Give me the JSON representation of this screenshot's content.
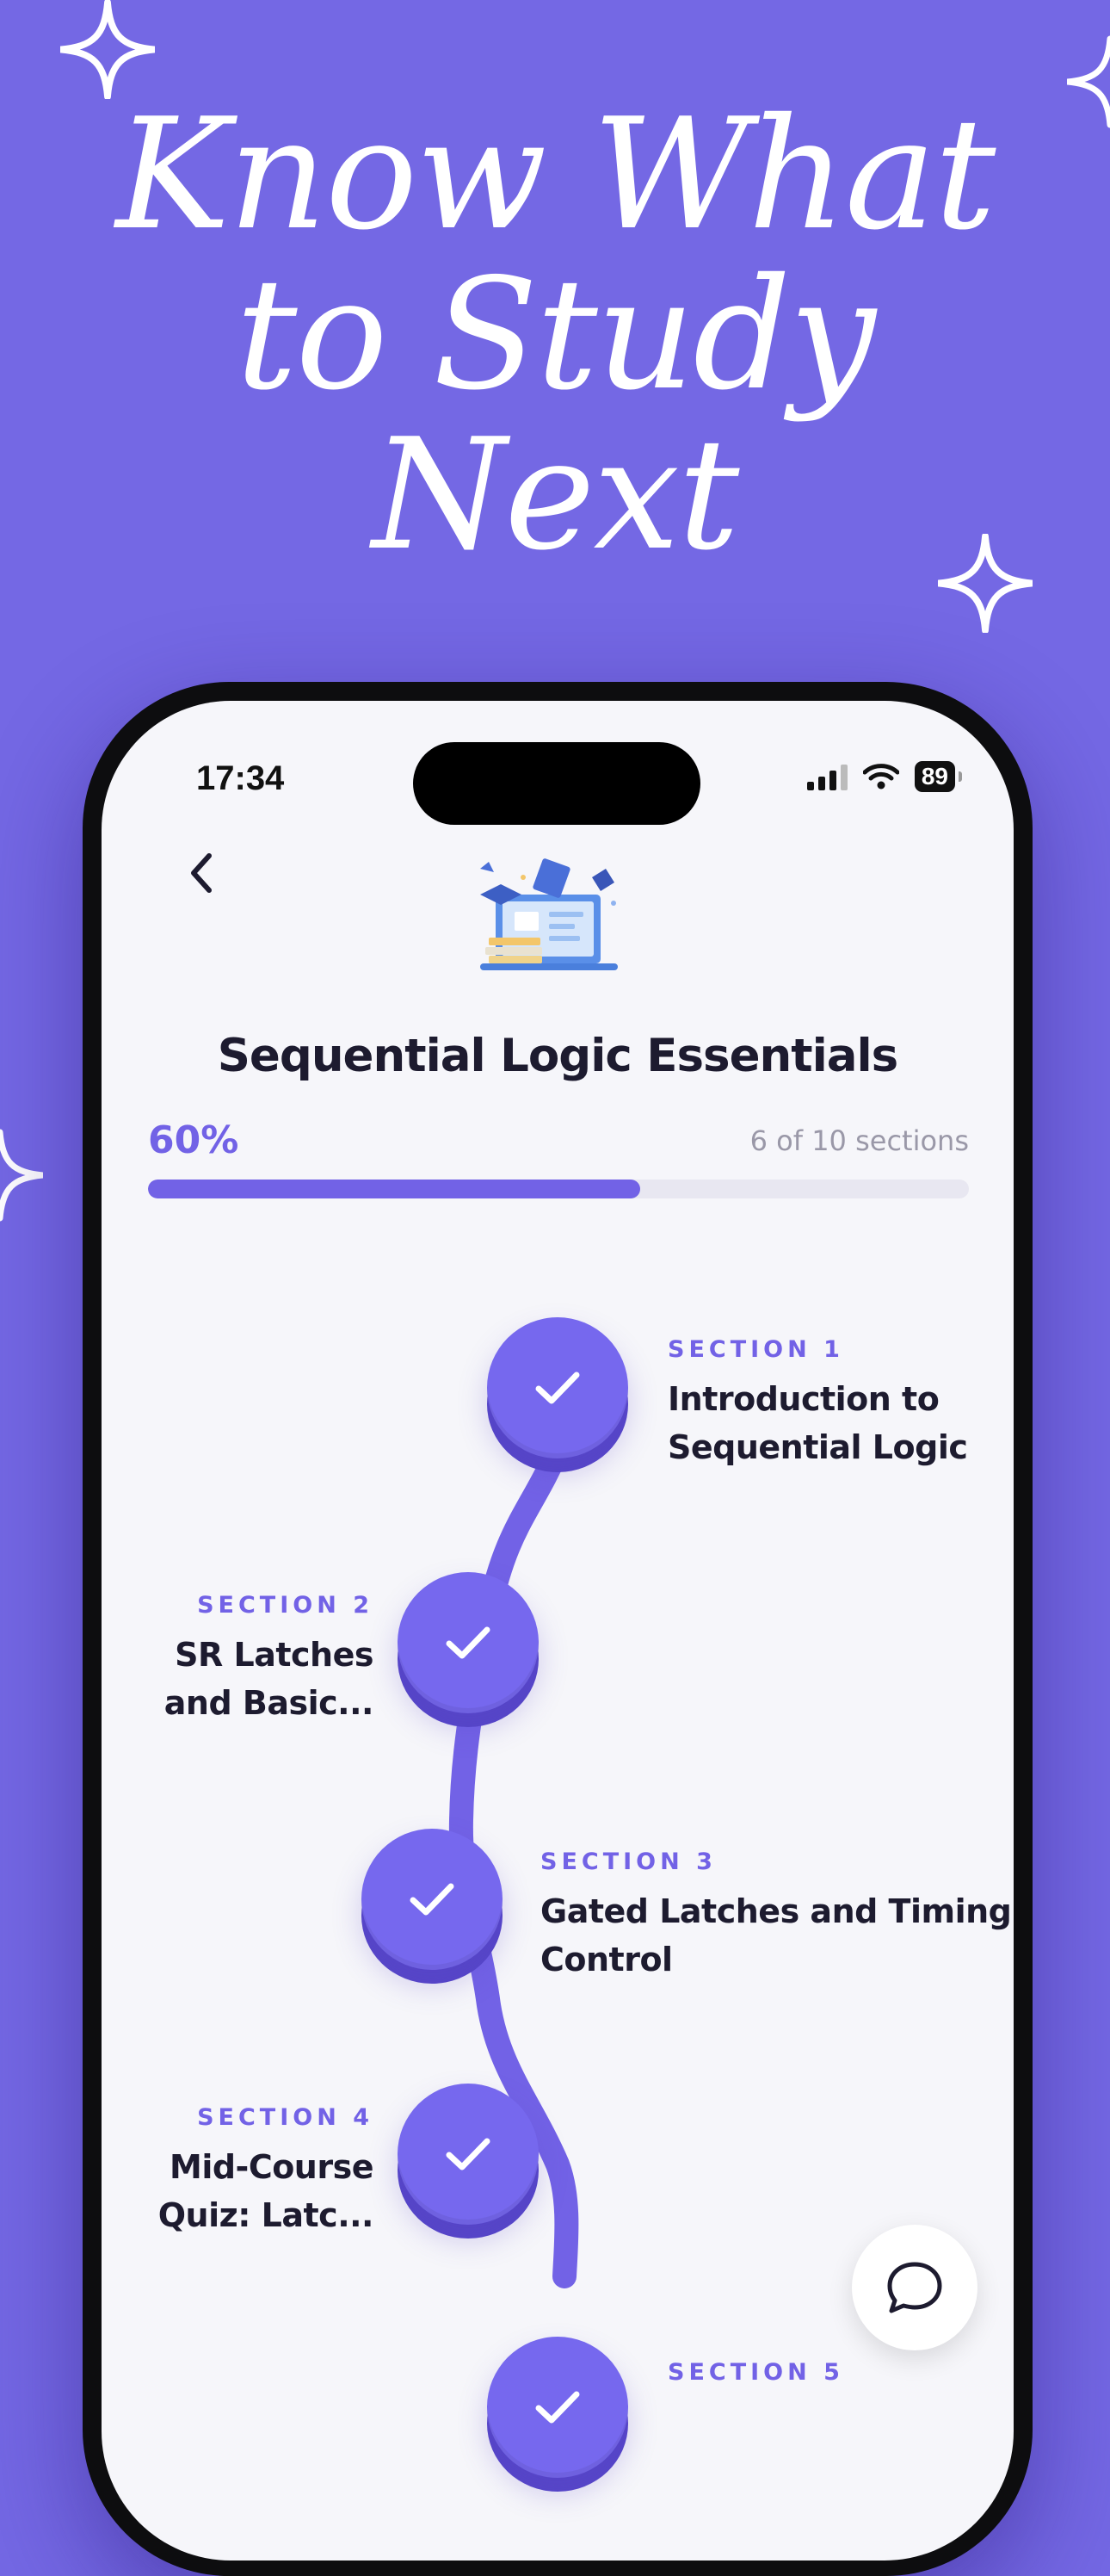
{
  "headline": {
    "line1": "Know What",
    "line2": "to Study",
    "line3": "Next"
  },
  "status_bar": {
    "time": "17:34",
    "battery": "89"
  },
  "course": {
    "title": "Sequential Logic Essentials",
    "progress_percent_label": "60%",
    "progress_fraction": 0.6,
    "sections_count": "6 of 10 sections"
  },
  "sections": [
    {
      "label": "SECTION 1",
      "name_line1": "Introduction to",
      "name_line2": "Sequential Logic",
      "completed": true
    },
    {
      "label": "SECTION 2",
      "name_line1": "SR Latches",
      "name_line2": "and Basic...",
      "completed": true
    },
    {
      "label": "SECTION 3",
      "name_line1": "Gated Latches and Timing",
      "name_line2": "Control",
      "completed": true
    },
    {
      "label": "SECTION 4",
      "name_line1": "Mid-Course",
      "name_line2": "Quiz: Latc...",
      "completed": true
    },
    {
      "label": "SECTION 5",
      "name_line1": "",
      "name_line2": "",
      "completed": true
    }
  ],
  "colors": {
    "background": "#7468e4",
    "accent": "#7262e6",
    "node": "#7668ee",
    "node_shadow": "#5545c8"
  },
  "icons": {
    "back": "chevron-left-icon",
    "check": "checkmark-icon",
    "chat": "chat-bubble-icon",
    "sparkle": "sparkle-icon"
  }
}
